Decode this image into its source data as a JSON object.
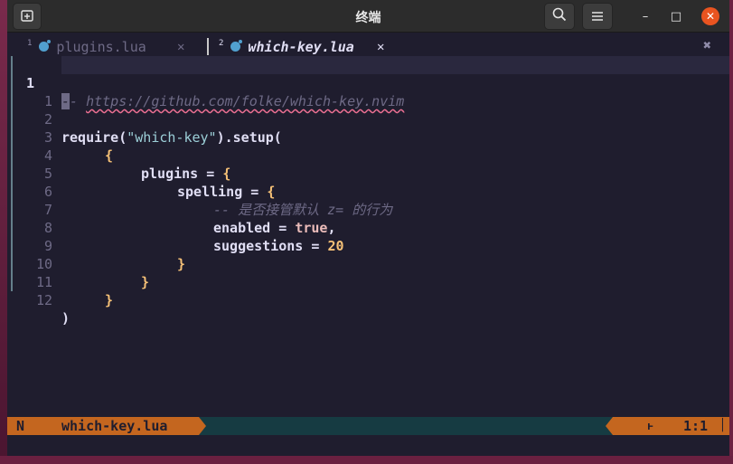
{
  "window": {
    "title": "终端"
  },
  "titlebar": {
    "new_tab_icon": "new-tab-icon",
    "search_icon": "search-icon",
    "menu_icon": "hamburger-menu-icon",
    "minimize_glyph": "–",
    "maximize_glyph": "□",
    "close_glyph": "✕"
  },
  "tabs": [
    {
      "number": "1",
      "label": "plugins.lua",
      "close": "✕",
      "active": false
    },
    {
      "number": "2",
      "label": "which-key.lua",
      "close": "✕",
      "active": true
    }
  ],
  "tabline_close": "✖",
  "editor": {
    "current_line": "1",
    "lines": [
      {
        "number": "1",
        "text": "-- https://github.com/folke/which-key.nvim"
      },
      {
        "number": "1",
        "text": ""
      },
      {
        "number": "2",
        "text": "require(\"which-key\").setup("
      },
      {
        "number": "3",
        "text": "{"
      },
      {
        "number": "4",
        "text": "plugins = {"
      },
      {
        "number": "5",
        "text": "spelling = {"
      },
      {
        "number": "6",
        "text": "-- 是否接管默认 z= 的行为"
      },
      {
        "number": "7",
        "text": "enabled = true,"
      },
      {
        "number": "8",
        "text": "suggestions = 20"
      },
      {
        "number": "9",
        "text": "}"
      },
      {
        "number": "10",
        "text": "}"
      },
      {
        "number": "11",
        "text": "}"
      },
      {
        "number": "12",
        "text": ")"
      }
    ],
    "tokens": {
      "comment_prefix": "-",
      "comment_dash": "- ",
      "url": "https://github.com/folke/which-key.nvim",
      "require": "require",
      "open_paren": "(",
      "string": "\"which-key\"",
      "setup": ").setup(",
      "brace_open": "{",
      "brace_close": "}",
      "plugins_key": "plugins",
      "spelling_key": "spelling",
      "assign": " = ",
      "comment6": "-- 是否接管默认 z= 的行为",
      "enabled_key": "enabled",
      "true_value": "true",
      "comma": ",",
      "suggestions_key": "suggestions",
      "suggestions_value": "20",
      "close_paren": ")"
    }
  },
  "statusline": {
    "mode": "N",
    "filename": "which-key.lua",
    "branch_glyph": "ⱶ",
    "position": "1:1",
    "tick": "▕"
  },
  "colors": {
    "background": "#1f1d2e",
    "statusline_accent": "#c4661f",
    "close_button": "#e95420",
    "string": "#9ccfd8",
    "number": "#f6c177",
    "comment": "#6e6a86"
  }
}
